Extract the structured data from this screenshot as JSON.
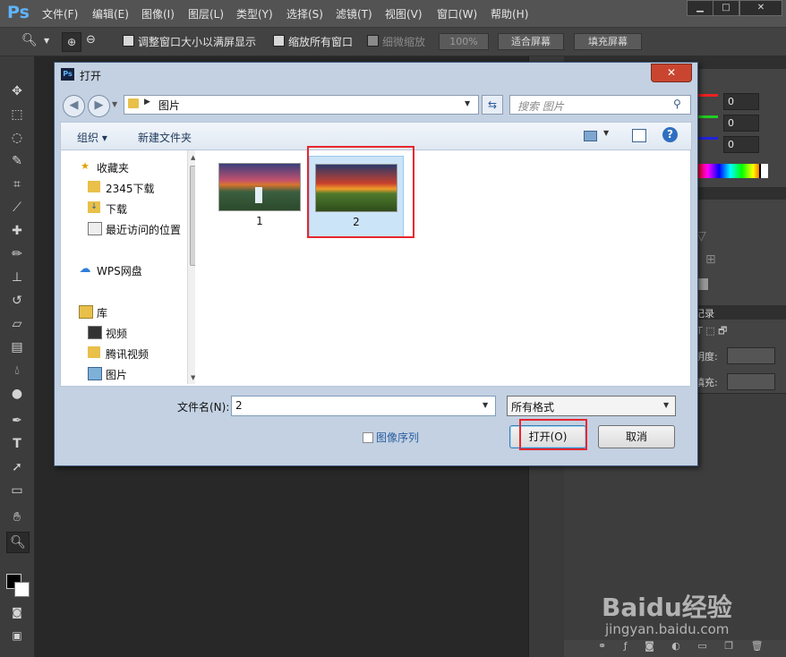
{
  "app": {
    "logo": "Ps",
    "menu": [
      "文件(F)",
      "编辑(E)",
      "图像(I)",
      "图层(L)",
      "类型(Y)",
      "选择(S)",
      "滤镜(T)",
      "视图(V)",
      "窗口(W)",
      "帮助(H)"
    ],
    "window_buttons": [
      "▁",
      "□",
      "✕"
    ]
  },
  "options_bar": {
    "resize_windows": "调整窗口大小以满屏显示",
    "zoom_all": "缩放所有窗口",
    "scrubby_zoom": "细微缩放",
    "zoom_level": "100%",
    "fit_screen": "适合屏幕",
    "fill_screen": "填充屏幕"
  },
  "panels": {
    "rgb_values": [
      "0",
      "0",
      "0"
    ],
    "history_tab": "记录",
    "opacity_label": "明度:",
    "fill_label": "填充:"
  },
  "dialog": {
    "title": "打开",
    "app_icon": "Ps",
    "close": "✕",
    "address": "图片",
    "search_placeholder": "搜索 图片",
    "organize": "组织 ▾",
    "new_folder": "新建文件夹",
    "help": "?",
    "nav": {
      "favorites": "收藏夹",
      "fav_items": [
        "2345下载",
        "下载",
        "最近访问的位置"
      ],
      "wps": "WPS网盘",
      "library": "库",
      "lib_items": [
        "视频",
        "腾讯视频",
        "图片"
      ]
    },
    "files": [
      {
        "name": "1",
        "selected": false
      },
      {
        "name": "2",
        "selected": true
      }
    ],
    "filename_label": "文件名(N):",
    "filename_value": "2",
    "filetype_value": "所有格式",
    "image_sequence": "图像序列",
    "open_button": "打开(O)",
    "cancel_button": "取消"
  },
  "watermark": {
    "brand": "Baidu经验",
    "url": "jingyan.baidu.com"
  },
  "colors": {
    "highlight": "#e8262e",
    "selection": "#cce4f7",
    "ps_blue": "#5fb4ff"
  }
}
